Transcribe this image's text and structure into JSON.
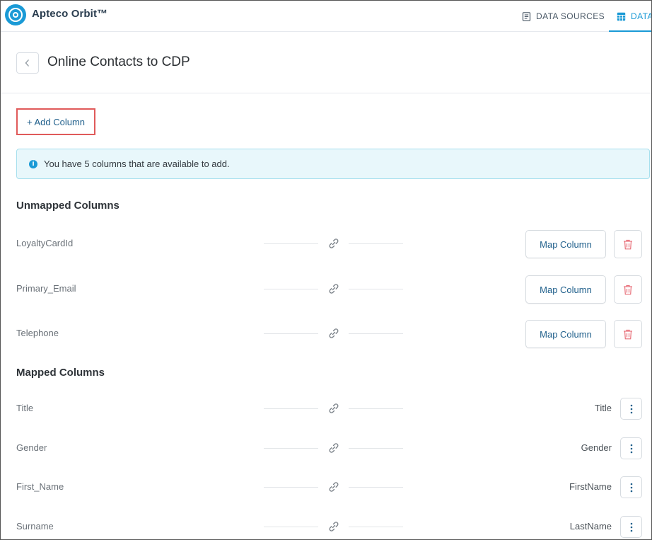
{
  "app": {
    "title": "Apteco Orbit™"
  },
  "nav": {
    "items": [
      {
        "label": "DATA SOURCES",
        "icon": "document-icon"
      },
      {
        "label": "DATA",
        "icon": "table-icon",
        "active": true
      }
    ],
    "accent_color": "#1a9ad6"
  },
  "page": {
    "title": "Online Contacts to CDP"
  },
  "toolbar": {
    "add_column_label": "+ Add Column"
  },
  "alert": {
    "message": "You have 5 columns that are available to add.",
    "icon": "info-icon"
  },
  "unmapped": {
    "title": "Unmapped Columns",
    "button_label": "Map Column",
    "rows": [
      {
        "name": "LoyaltyCardId"
      },
      {
        "name": "Primary_Email"
      },
      {
        "name": "Telephone"
      }
    ]
  },
  "mapped": {
    "title": "Mapped Columns",
    "rows": [
      {
        "name": "Title",
        "target": "Title"
      },
      {
        "name": "Gender",
        "target": "Gender"
      },
      {
        "name": "First_Name",
        "target": "FirstName"
      },
      {
        "name": "Surname",
        "target": "LastName"
      }
    ]
  },
  "colors": {
    "primary_text": "#1f5f8b",
    "delete": "#e8707a",
    "highlight_box": "#e05a5a"
  }
}
